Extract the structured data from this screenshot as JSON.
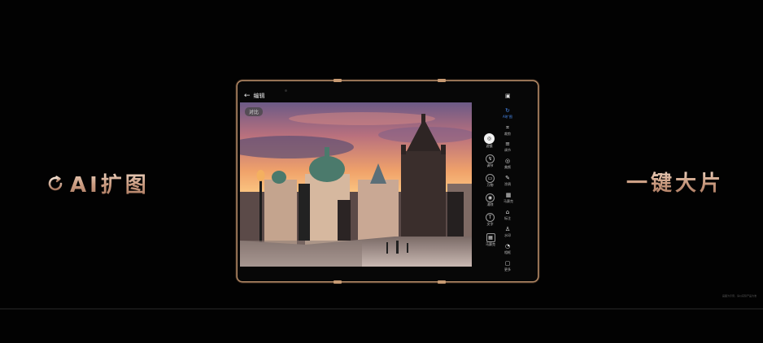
{
  "left_title": {
    "icon": "refresh-ai-icon",
    "text": "AI扩图"
  },
  "right_title": {
    "text": "一键大片"
  },
  "app": {
    "back_icon": "arrow-left-icon",
    "title": "编辑",
    "compare_label": "对比"
  },
  "tools": [
    {
      "name": "tool-1",
      "icon": "circle-filter-icon",
      "label": "滤镜",
      "selected": true
    },
    {
      "name": "tool-2",
      "icon": "adjust-icon",
      "label": "调节",
      "selected": false
    },
    {
      "name": "tool-3",
      "icon": "image-icon",
      "label": "万物",
      "selected": false
    },
    {
      "name": "tool-4",
      "icon": "eye-icon",
      "label": "消除",
      "selected": false
    },
    {
      "name": "tool-5",
      "icon": "text-icon",
      "label": "文字",
      "selected": false
    },
    {
      "name": "tool-6",
      "icon": "grid-icon",
      "label": "马赛克",
      "selected": false
    }
  ],
  "right_tools": [
    {
      "name": "save-icon",
      "glyph": "▣",
      "label": "",
      "active": false
    },
    {
      "name": "ai-expand-icon",
      "glyph": "↻",
      "label": "AI扩图",
      "active": true
    },
    {
      "name": "crop-icon",
      "glyph": "⌗",
      "label": "裁剪",
      "active": false
    },
    {
      "name": "adjust-icon",
      "glyph": "≡",
      "label": "调节",
      "active": false
    },
    {
      "name": "beauty-icon",
      "glyph": "◎",
      "label": "美颜",
      "active": false
    },
    {
      "name": "brush-icon",
      "glyph": "✎",
      "label": "涂鸦",
      "active": false
    },
    {
      "name": "mosaic-icon",
      "glyph": "▦",
      "label": "马赛克",
      "active": false
    },
    {
      "name": "tag-icon",
      "glyph": "⌂",
      "label": "标注",
      "active": false
    },
    {
      "name": "watermark-icon",
      "glyph": "♙",
      "label": "水印",
      "active": false
    },
    {
      "name": "frame-icon",
      "glyph": "◔",
      "label": "相框",
      "active": false
    },
    {
      "name": "more-icon",
      "glyph": "▢",
      "label": "更多",
      "active": false
    }
  ],
  "caption": "画面为示意，请以实际产品为准",
  "colors": {
    "accent": "#4a8cf2",
    "title_gradient_top": "#f4e0d0",
    "title_gradient_bottom": "#a9775e"
  }
}
